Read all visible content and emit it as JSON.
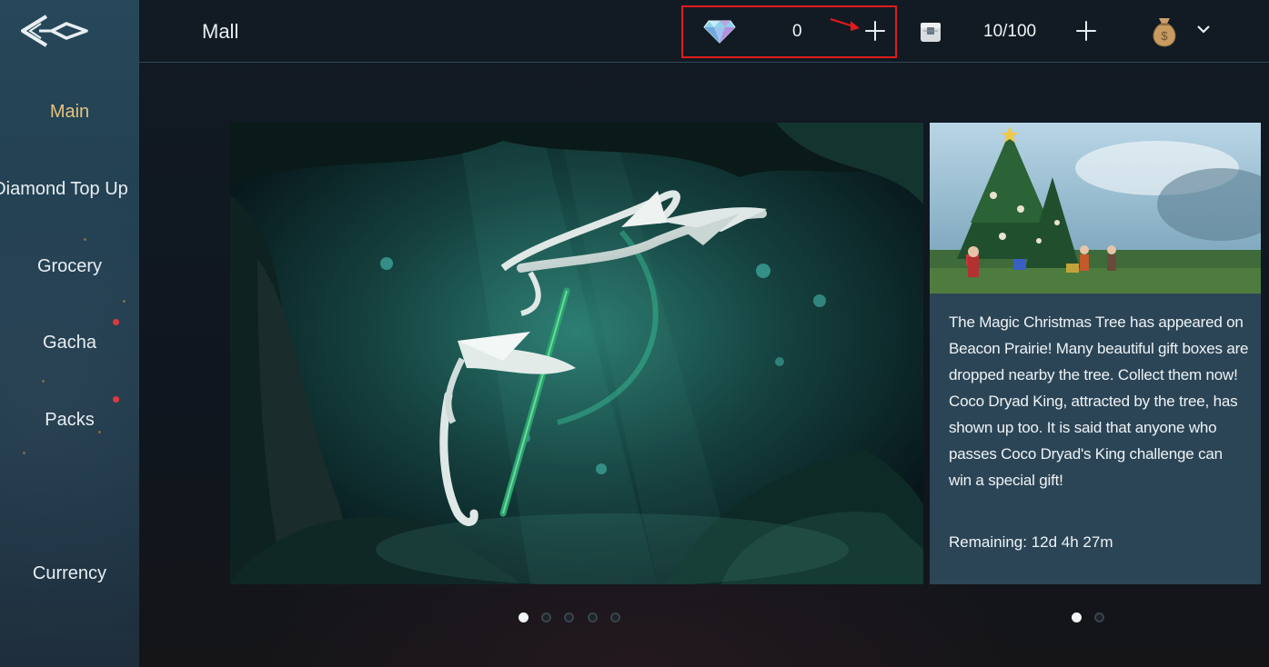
{
  "header": {
    "title": "Mall",
    "diamond_icon": "diamond-icon",
    "diamonds": "0",
    "storage_icon": "storage-chest-icon",
    "storage": "10/100",
    "wallet_icon": "money-bag-icon",
    "dropdown_icon": "chevron-down-icon"
  },
  "sidebar": {
    "back_icon": "back-arrow-icon",
    "items": [
      {
        "label": "Main",
        "active": true
      },
      {
        "label": "Diamond Top Up",
        "active": false
      },
      {
        "label": "Grocery",
        "active": false
      },
      {
        "label": "Gacha",
        "active": false,
        "notification": true
      },
      {
        "label": "Packs",
        "active": false,
        "notification": true
      },
      {
        "label": "Currency",
        "active": false
      }
    ]
  },
  "event": {
    "description": "The Magic Christmas Tree has appeared on Beacon Prairie! Many beautiful gift boxes are dropped nearby the tree. Collect them now! Coco Dryad King, attracted by the tree, has shown up too. It is said that anyone who passes Coco Dryad's King challenge can win a special gift!",
    "remaining": "Remaining: 12d 4h 27m"
  },
  "pagination": {
    "main_banner_pages": 5,
    "main_banner_active": 1,
    "event_pages": 2,
    "event_active": 1
  },
  "colors": {
    "accent_active": "#e6c27c",
    "notification": "#e0383e",
    "highlight": "#e11b1b"
  }
}
